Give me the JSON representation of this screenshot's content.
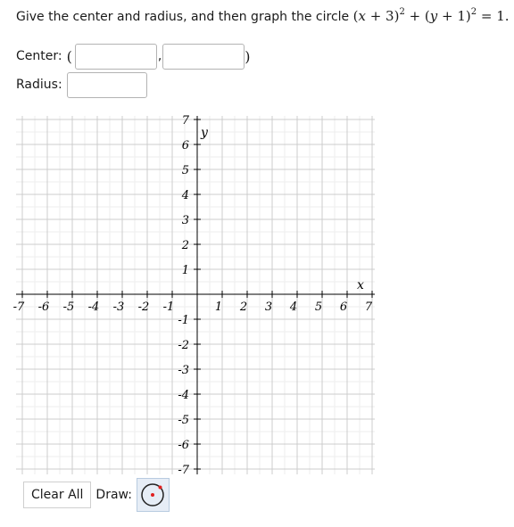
{
  "question": {
    "prompt": "Give the center and radius, and then graph the circle",
    "equation": {
      "open1": "(",
      "var1": "x",
      "op1": " + 3)",
      "exp1": "2",
      "plus": " + (",
      "var2": "y",
      "op2": " + 1)",
      "exp2": "2",
      "tail": " = 1."
    }
  },
  "center": {
    "label": "Center:",
    "open_paren": "(",
    "comma": ",",
    "close_paren": ")",
    "x_value": "",
    "y_value": ""
  },
  "radius": {
    "label": "Radius:",
    "value": ""
  },
  "graph": {
    "x_axis_label": "x",
    "y_axis_label": "y",
    "x_min": -7,
    "x_max": 7,
    "y_min": -7,
    "y_max": 7,
    "x_ticks": [
      "-7",
      "-6",
      "-5",
      "-4",
      "-3",
      "-2",
      "-1",
      "1",
      "2",
      "3",
      "4",
      "5",
      "6",
      "7"
    ],
    "y_ticks": [
      "7",
      "6",
      "5",
      "4",
      "3",
      "2",
      "1",
      "-1",
      "-2",
      "-3",
      "-4",
      "-5",
      "-6",
      "-7"
    ],
    "grid": true,
    "minor_divisions": 2
  },
  "toolbar": {
    "clear_label": "Clear All",
    "draw_label": "Draw:",
    "tool_icon": "circle-tool-icon",
    "tool_selected": true
  },
  "colors": {
    "grid_major": "#cccccc",
    "grid_minor": "#eeeeee",
    "axis": "#000000",
    "tool_bg": "#e6edf6",
    "tool_dot": "#e02020"
  }
}
